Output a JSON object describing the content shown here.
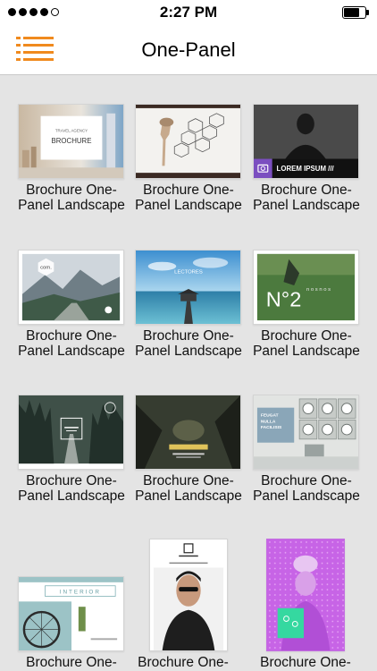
{
  "status": {
    "time": "2:27 PM"
  },
  "header": {
    "title": "One-Panel"
  },
  "templates": [
    {
      "caption": "Brochure One-Panel Landscape",
      "thumb_text": [
        "TRAVEL AGENCY",
        "BROCHURE"
      ]
    },
    {
      "caption": "Brochure One-Panel Landscape",
      "thumb_text": []
    },
    {
      "caption": "Brochure One-Panel Landscape",
      "thumb_text": [
        "LOREM IPSUM ///"
      ]
    },
    {
      "caption": "Brochure One-Panel Landscape",
      "thumb_text": [
        "com."
      ]
    },
    {
      "caption": "Brochure One-Panel Landscape",
      "thumb_text": [
        "LECTORES"
      ]
    },
    {
      "caption": "Brochure One-Panel Landscape",
      "thumb_text": [
        "N°2",
        "n o s  n o s"
      ]
    },
    {
      "caption": "Brochure One-Panel Landscape",
      "thumb_text": []
    },
    {
      "caption": "Brochure One-Panel Landscape",
      "thumb_text": []
    },
    {
      "caption": "Brochure One-Panel Landscape",
      "thumb_text": [
        "FEUGAT",
        "NULLA",
        "FACILISIS"
      ]
    },
    {
      "caption": "Brochure One-",
      "thumb_text": [
        "INTERIOR"
      ]
    },
    {
      "caption": "Brochure One-",
      "thumb_text": []
    },
    {
      "caption": "Brochure One-",
      "thumb_text": []
    }
  ]
}
